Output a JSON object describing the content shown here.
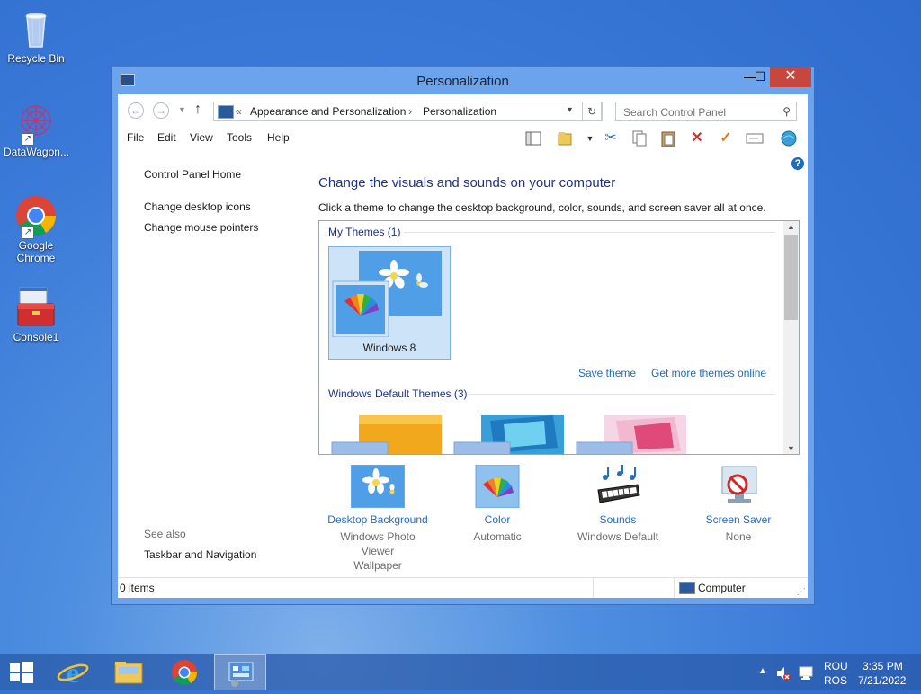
{
  "desktop": {
    "icons": [
      {
        "label": "Recycle Bin"
      },
      {
        "label": "DataWagon..."
      },
      {
        "label_line1": "Google",
        "label_line2": "Chrome"
      },
      {
        "label": "Console1"
      }
    ]
  },
  "window": {
    "title": "Personalization",
    "controls": {
      "minimize": "—",
      "maximize": "☐",
      "close": "✕"
    },
    "breadcrumb": {
      "sep": "«",
      "parent": "Appearance and Personalization",
      "arrow": "›",
      "current": "Personalization"
    },
    "search_placeholder": "Search Control Panel",
    "menu": [
      "File",
      "Edit",
      "View",
      "Tools",
      "Help"
    ],
    "left_pane": {
      "home": "Control Panel Home",
      "links": [
        "Change desktop icons",
        "Change mouse pointers"
      ],
      "see_also_label": "See also",
      "see_also_links": [
        "Taskbar and Navigation"
      ]
    },
    "main": {
      "heading": "Change the visuals and sounds on your computer",
      "description": "Click a theme to change the desktop background, color, sounds, and screen saver all at once.",
      "my_themes_header": "My Themes (1)",
      "selected_theme": "Windows 8",
      "save_theme": "Save theme",
      "get_more": "Get more themes online",
      "default_themes_header": "Windows Default Themes (3)"
    },
    "bottom": [
      {
        "label": "Desktop Background",
        "value_line1": "Windows Photo Viewer",
        "value_line2": "Wallpaper"
      },
      {
        "label": "Color",
        "value_line1": "Automatic",
        "value_line2": ""
      },
      {
        "label": "Sounds",
        "value_line1": "Windows Default",
        "value_line2": ""
      },
      {
        "label": "Screen Saver",
        "value_line1": "None",
        "value_line2": ""
      }
    ],
    "status": {
      "items": "0 items",
      "location": "Computer"
    }
  },
  "taskbar": {
    "lang_line1": "ROU",
    "lang_line2": "ROS",
    "time": "3:35 PM",
    "date": "7/21/2022"
  },
  "colors": {
    "accent_link": "#1e6bc4",
    "heading": "#1e3287",
    "close_button": "#c7463d"
  }
}
